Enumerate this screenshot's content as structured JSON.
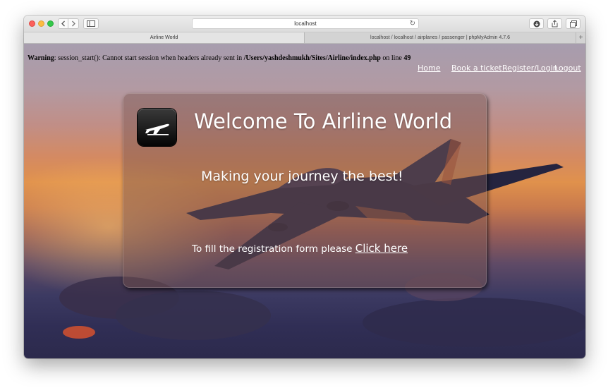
{
  "browser": {
    "address": "localhost",
    "tabs": [
      {
        "label": "Airline World"
      },
      {
        "label": "localhost / localhost / airplanes / passenger | phpMyAdmin 4.7.6"
      }
    ],
    "reload_icon": "reload-icon",
    "back_icon": "chevron-left-icon",
    "forward_icon": "chevron-right-icon",
    "sidebar_icon": "sidebar-icon",
    "download_icon": "download-icon",
    "share_icon": "share-icon",
    "tabs_icon": "tabs-overview-icon",
    "new_tab_icon": "plus-icon"
  },
  "warning": {
    "label": "Warning",
    "message": ": session_start(): Cannot start session when headers already sent in ",
    "path": "/Users/yashdeshmukh/Sites/Airline/index.php",
    "on_line": " on line ",
    "line": "49"
  },
  "nav": {
    "home": "Home",
    "book": "Book a ticket",
    "register": "Register/Login",
    "logout": "Logout"
  },
  "hero": {
    "title": "Welcome To Airline World",
    "tagline": "Making your journey the best!",
    "register_text": "To fill the registration form please ",
    "register_link": "Click here",
    "logo_icon": "airplane-takeoff-icon"
  },
  "colors": {
    "traffic_close": "#fc605b",
    "traffic_min": "#fdbc40",
    "traffic_max": "#34c84a",
    "text_white": "#ffffff"
  }
}
